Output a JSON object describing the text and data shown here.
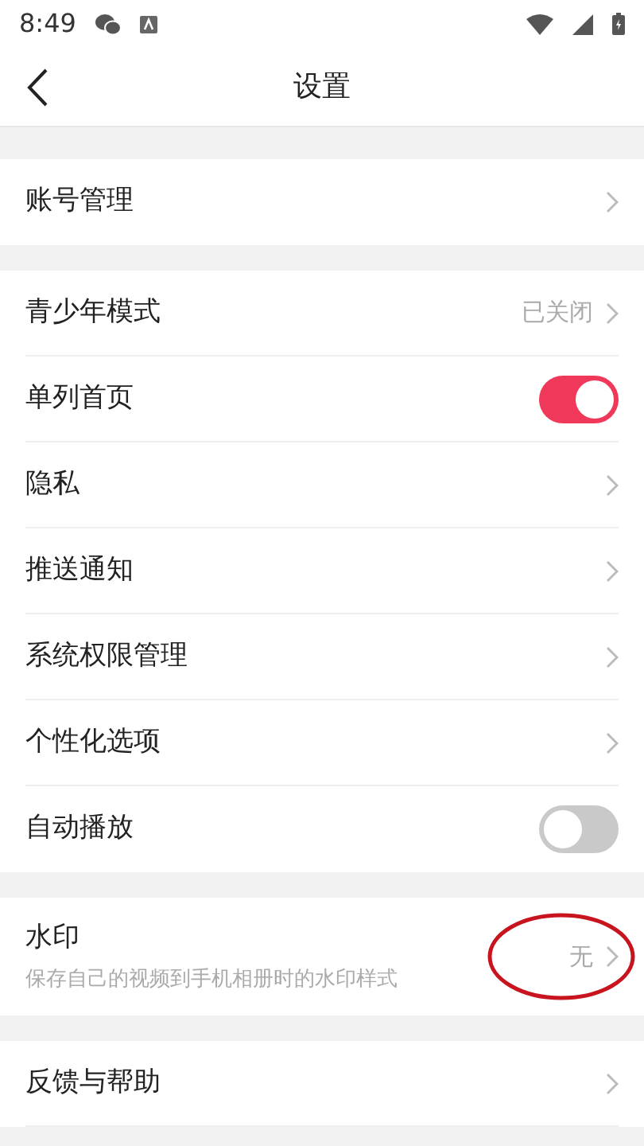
{
  "status_bar": {
    "time": "8:49"
  },
  "header": {
    "title": "设置"
  },
  "groups": [
    {
      "items": [
        {
          "kind": "link",
          "label": "账号管理"
        }
      ]
    },
    {
      "items": [
        {
          "kind": "link",
          "label": "青少年模式",
          "value": "已关闭"
        },
        {
          "kind": "toggle",
          "label": "单列首页",
          "on": true
        },
        {
          "kind": "link",
          "label": "隐私"
        },
        {
          "kind": "link",
          "label": "推送通知"
        },
        {
          "kind": "link",
          "label": "系统权限管理"
        },
        {
          "kind": "link",
          "label": "个性化选项"
        },
        {
          "kind": "toggle",
          "label": "自动播放",
          "on": false
        }
      ]
    },
    {
      "items": [
        {
          "kind": "link",
          "label": "水印",
          "subtitle": "保存自己的视频到手机相册时的水印样式",
          "value": "无",
          "circled": true
        }
      ]
    },
    {
      "items": [
        {
          "kind": "link",
          "label": "反馈与帮助"
        }
      ]
    }
  ]
}
